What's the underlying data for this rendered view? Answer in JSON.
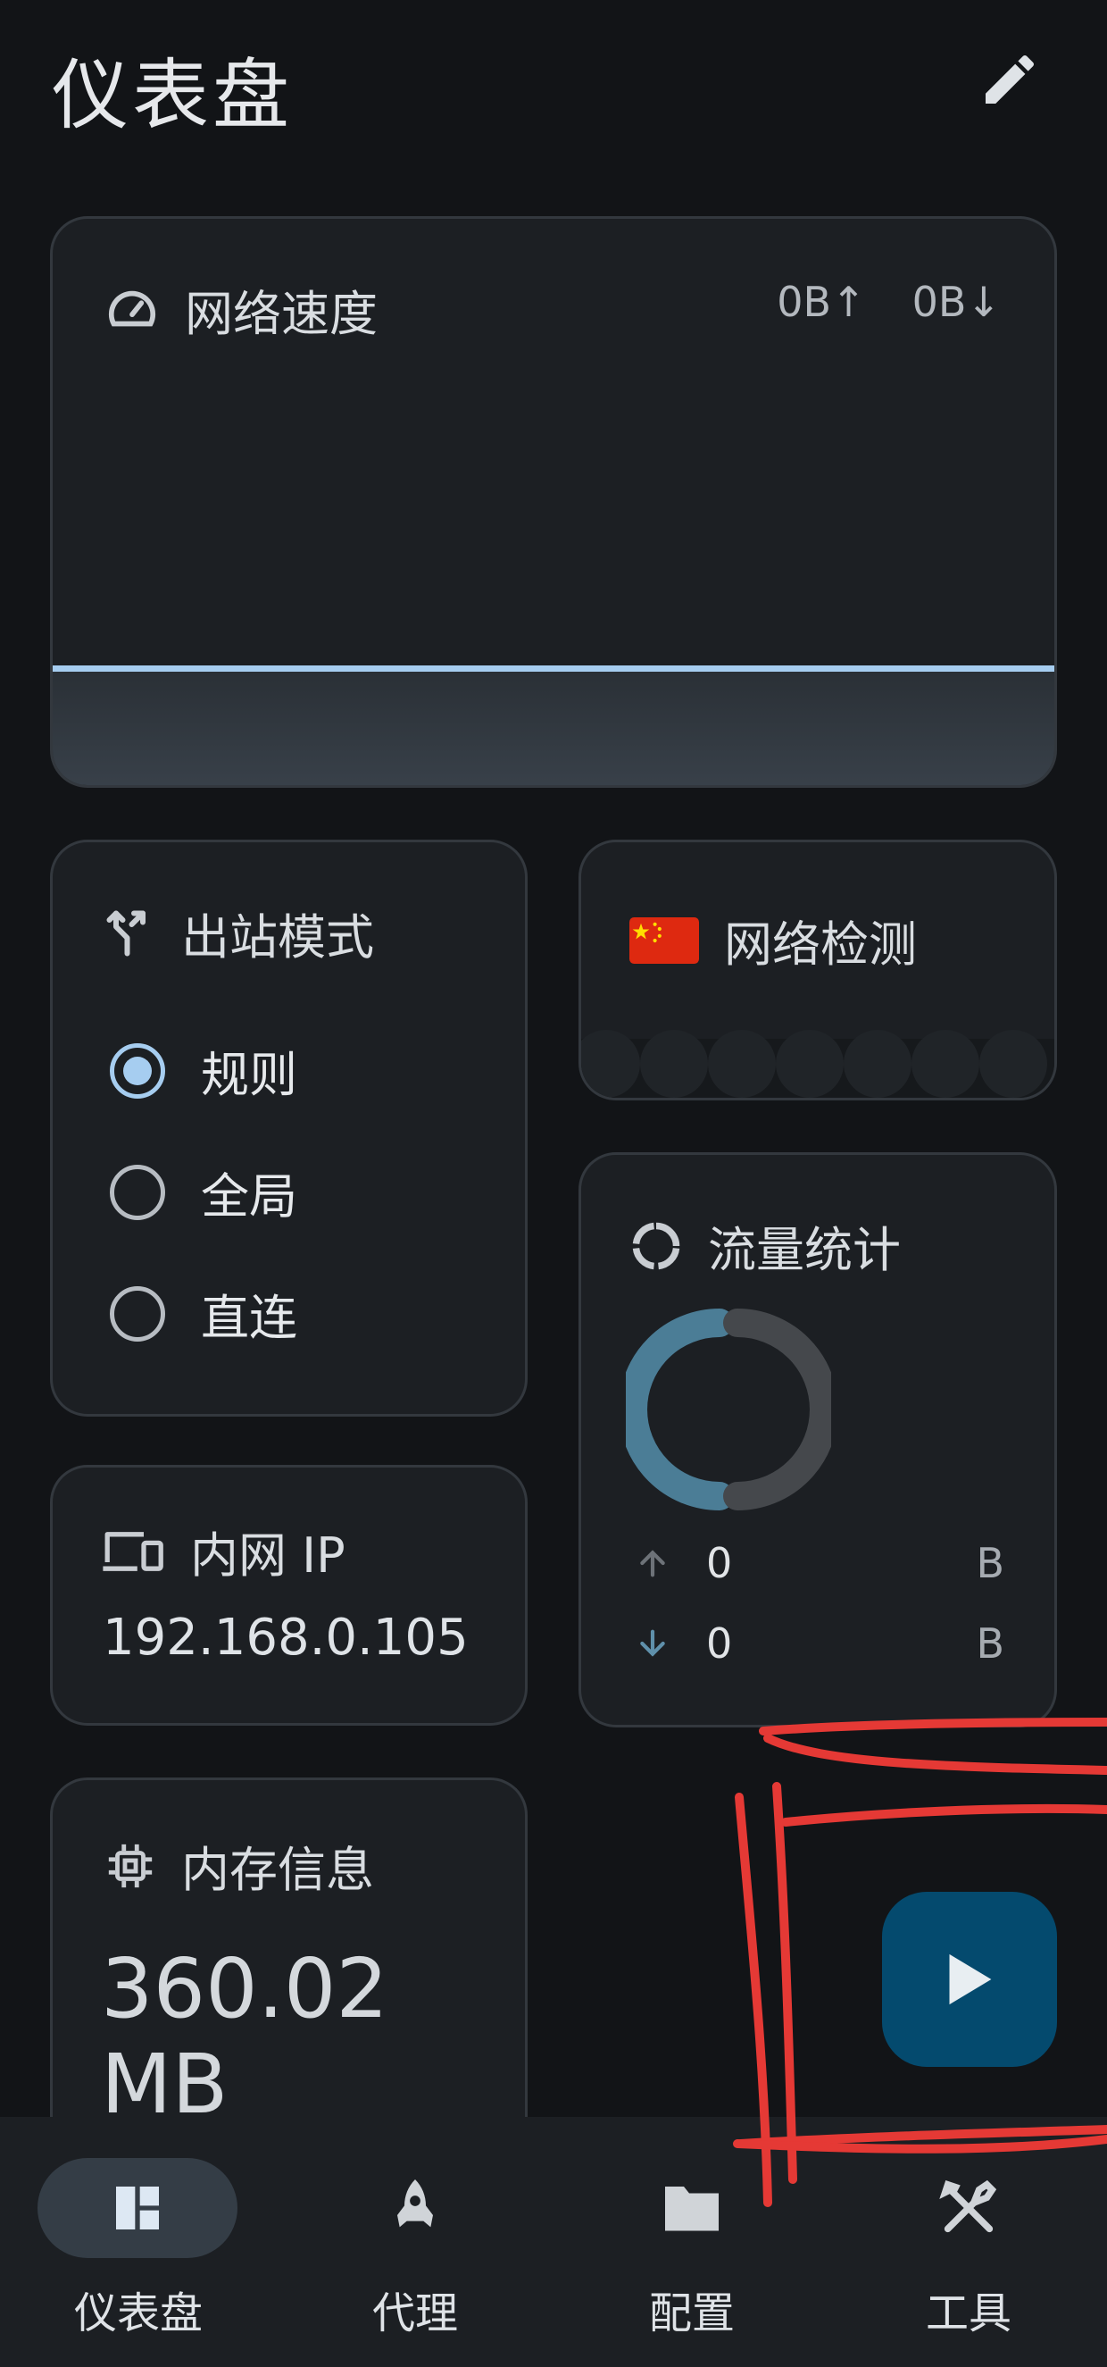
{
  "header": {
    "title": "仪表盘",
    "edit_icon": "pencil-icon"
  },
  "network_speed": {
    "title": "网络速度",
    "icon": "speedometer-icon",
    "upload": "0B↑",
    "download": "0B↓"
  },
  "outbound_mode": {
    "title": "出站模式",
    "icon": "route-icon",
    "options": [
      {
        "label": "规则",
        "selected": true
      },
      {
        "label": "全局",
        "selected": false
      },
      {
        "label": "直连",
        "selected": false
      }
    ]
  },
  "network_check": {
    "title": "网络检测",
    "icon": "china-flag-icon"
  },
  "traffic": {
    "title": "流量统计",
    "icon": "donut-icon",
    "upload_value": "0",
    "upload_unit": "B",
    "download_value": "0",
    "download_unit": "B"
  },
  "lan_ip": {
    "title": "内网 IP",
    "icon": "devices-icon",
    "value": "192.168.0.105"
  },
  "memory": {
    "title": "内存信息",
    "icon": "chip-icon",
    "value": "360.02 MB"
  },
  "fab": {
    "icon": "play-icon"
  },
  "bottom_nav": {
    "items": [
      {
        "label": "仪表盘",
        "icon": "dashboard-icon",
        "active": true
      },
      {
        "label": "代理",
        "icon": "rocket-icon",
        "active": false
      },
      {
        "label": "配置",
        "icon": "folder-icon",
        "active": false
      },
      {
        "label": "工具",
        "icon": "tools-icon",
        "active": false
      }
    ]
  },
  "colors": {
    "background": "#121417",
    "card": "#1c1f23",
    "accent": "#a6cdf0",
    "fab": "#044a6e",
    "annotation": "#e53935"
  }
}
